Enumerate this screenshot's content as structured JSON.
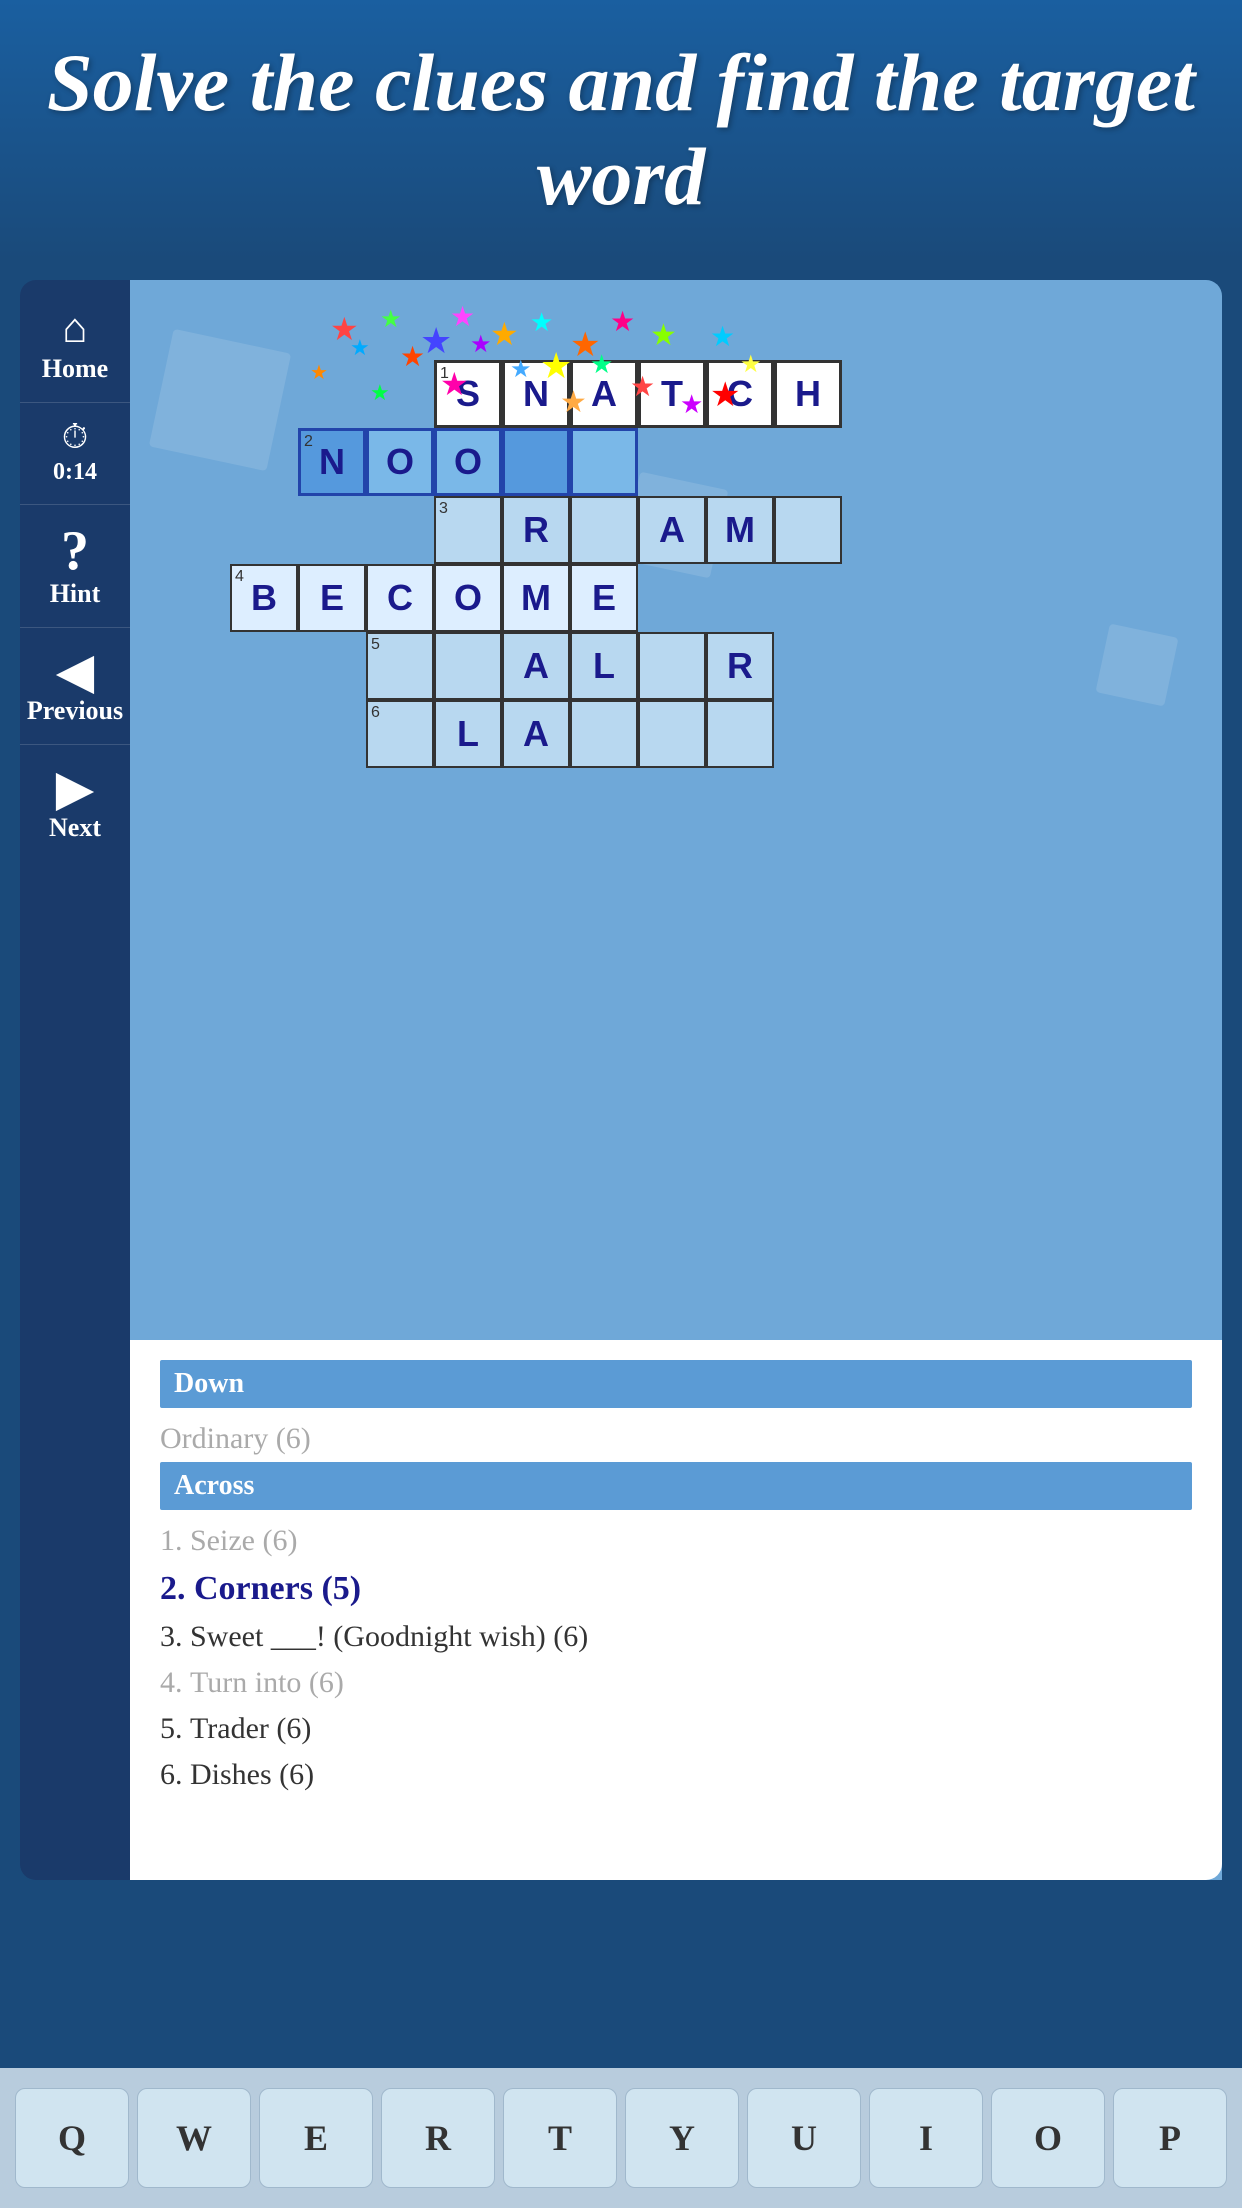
{
  "header": {
    "title": "Solve the clues and find the target word"
  },
  "sidebar": {
    "home_label": "Home",
    "timer_label": "0:14",
    "hint_label": "Hint",
    "previous_label": "Previous",
    "next_label": "Next"
  },
  "crossword": {
    "rows": [
      {
        "clue_num": "1",
        "word": "SNATCH",
        "row": 0
      },
      {
        "clue_num": "2",
        "word": "NOO__",
        "row": 1
      },
      {
        "clue_num": "3",
        "word": "__R_AM_",
        "row": 2
      },
      {
        "clue_num": "4",
        "word": "BECOME",
        "row": 3
      },
      {
        "clue_num": "5",
        "word": "__AL_R",
        "row": 4
      },
      {
        "clue_num": "6",
        "word": "_LA__",
        "row": 5
      }
    ]
  },
  "clues": {
    "down_header": "Down",
    "down_items": [
      {
        "text": "Ordinary (6)",
        "state": "solved"
      }
    ],
    "across_header": "Across",
    "across_items": [
      {
        "number": "1.",
        "text": "Seize (6)",
        "state": "solved"
      },
      {
        "number": "2.",
        "text": "Corners (5)",
        "state": "active"
      },
      {
        "number": "3.",
        "text": "Sweet ___! (Goodnight wish) (6)",
        "state": "normal"
      },
      {
        "number": "4.",
        "text": "Turn into (6)",
        "state": "solved"
      },
      {
        "number": "5.",
        "text": "Trader (6)",
        "state": "normal"
      },
      {
        "number": "6.",
        "text": "Dishes (6)",
        "state": "normal"
      }
    ]
  },
  "keyboard": {
    "keys": [
      "Q",
      "W",
      "E",
      "R",
      "T",
      "Y",
      "U",
      "I",
      "O",
      "P"
    ]
  }
}
